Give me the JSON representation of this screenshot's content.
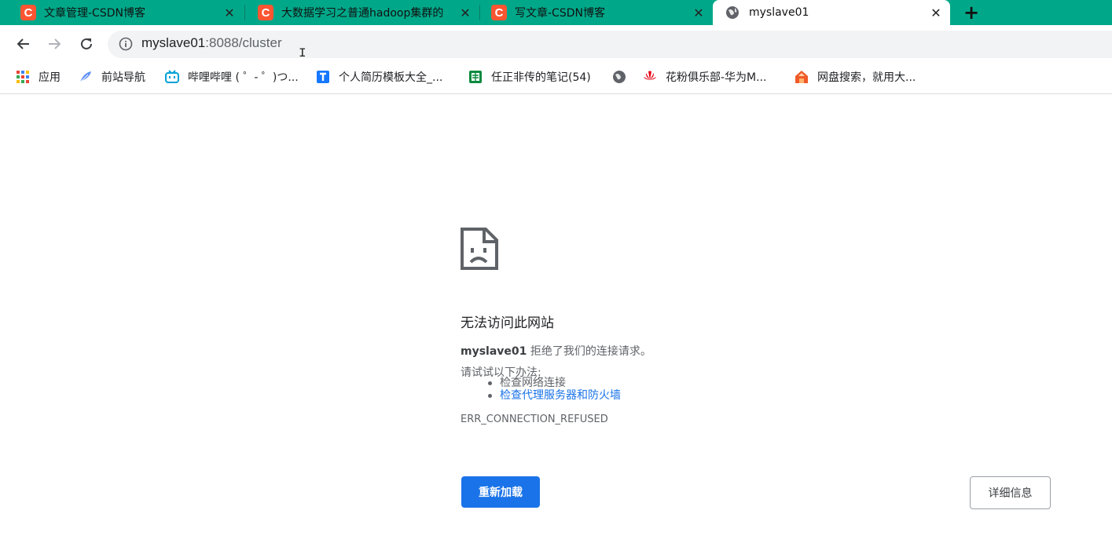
{
  "tabs": [
    {
      "title": "文章管理-CSDN博客",
      "favicon": "C"
    },
    {
      "title": "大数据学习之普通hadoop集群的",
      "favicon": "C"
    },
    {
      "title": "写文章-CSDN博客",
      "favicon": "C"
    },
    {
      "title": "myslave01",
      "favicon": "globe-icon"
    }
  ],
  "newtab_label": "+",
  "address": {
    "host": "myslave01",
    "path": ":8088/cluster"
  },
  "bookmarks": [
    {
      "label": "应用",
      "icon": "apps-grid-icon"
    },
    {
      "label": "前站导航",
      "icon": "feather-icon"
    },
    {
      "label": "哔哩哔哩 ( ゜- ゜)つ...",
      "icon": "bilibili-icon"
    },
    {
      "label": "个人简历模板大全_...",
      "icon": "resume-icon"
    },
    {
      "label": "任正非传的笔记(54)",
      "icon": "notes-icon"
    },
    {
      "label": "",
      "icon": "globe-icon"
    },
    {
      "label": "花粉俱乐部-华为M...",
      "icon": "huawei-icon"
    },
    {
      "label": "网盘搜索，就用大...",
      "icon": "search-cloud-icon"
    }
  ],
  "error": {
    "title": "无法访问此网站",
    "host": "myslave01",
    "message": " 拒绝了我们的连接请求。",
    "try_label": "请试试以下办法:",
    "suggestions": [
      "检查网络连接",
      "检查代理服务器和防火墙"
    ],
    "code": "ERR_CONNECTION_REFUSED",
    "reload_label": "重新加载",
    "details_label": "详细信息"
  },
  "colors": {
    "tabstrip": "#00a889",
    "csdn": "#fc5531",
    "button": "#1a73e8",
    "link": "#1a73e8"
  }
}
